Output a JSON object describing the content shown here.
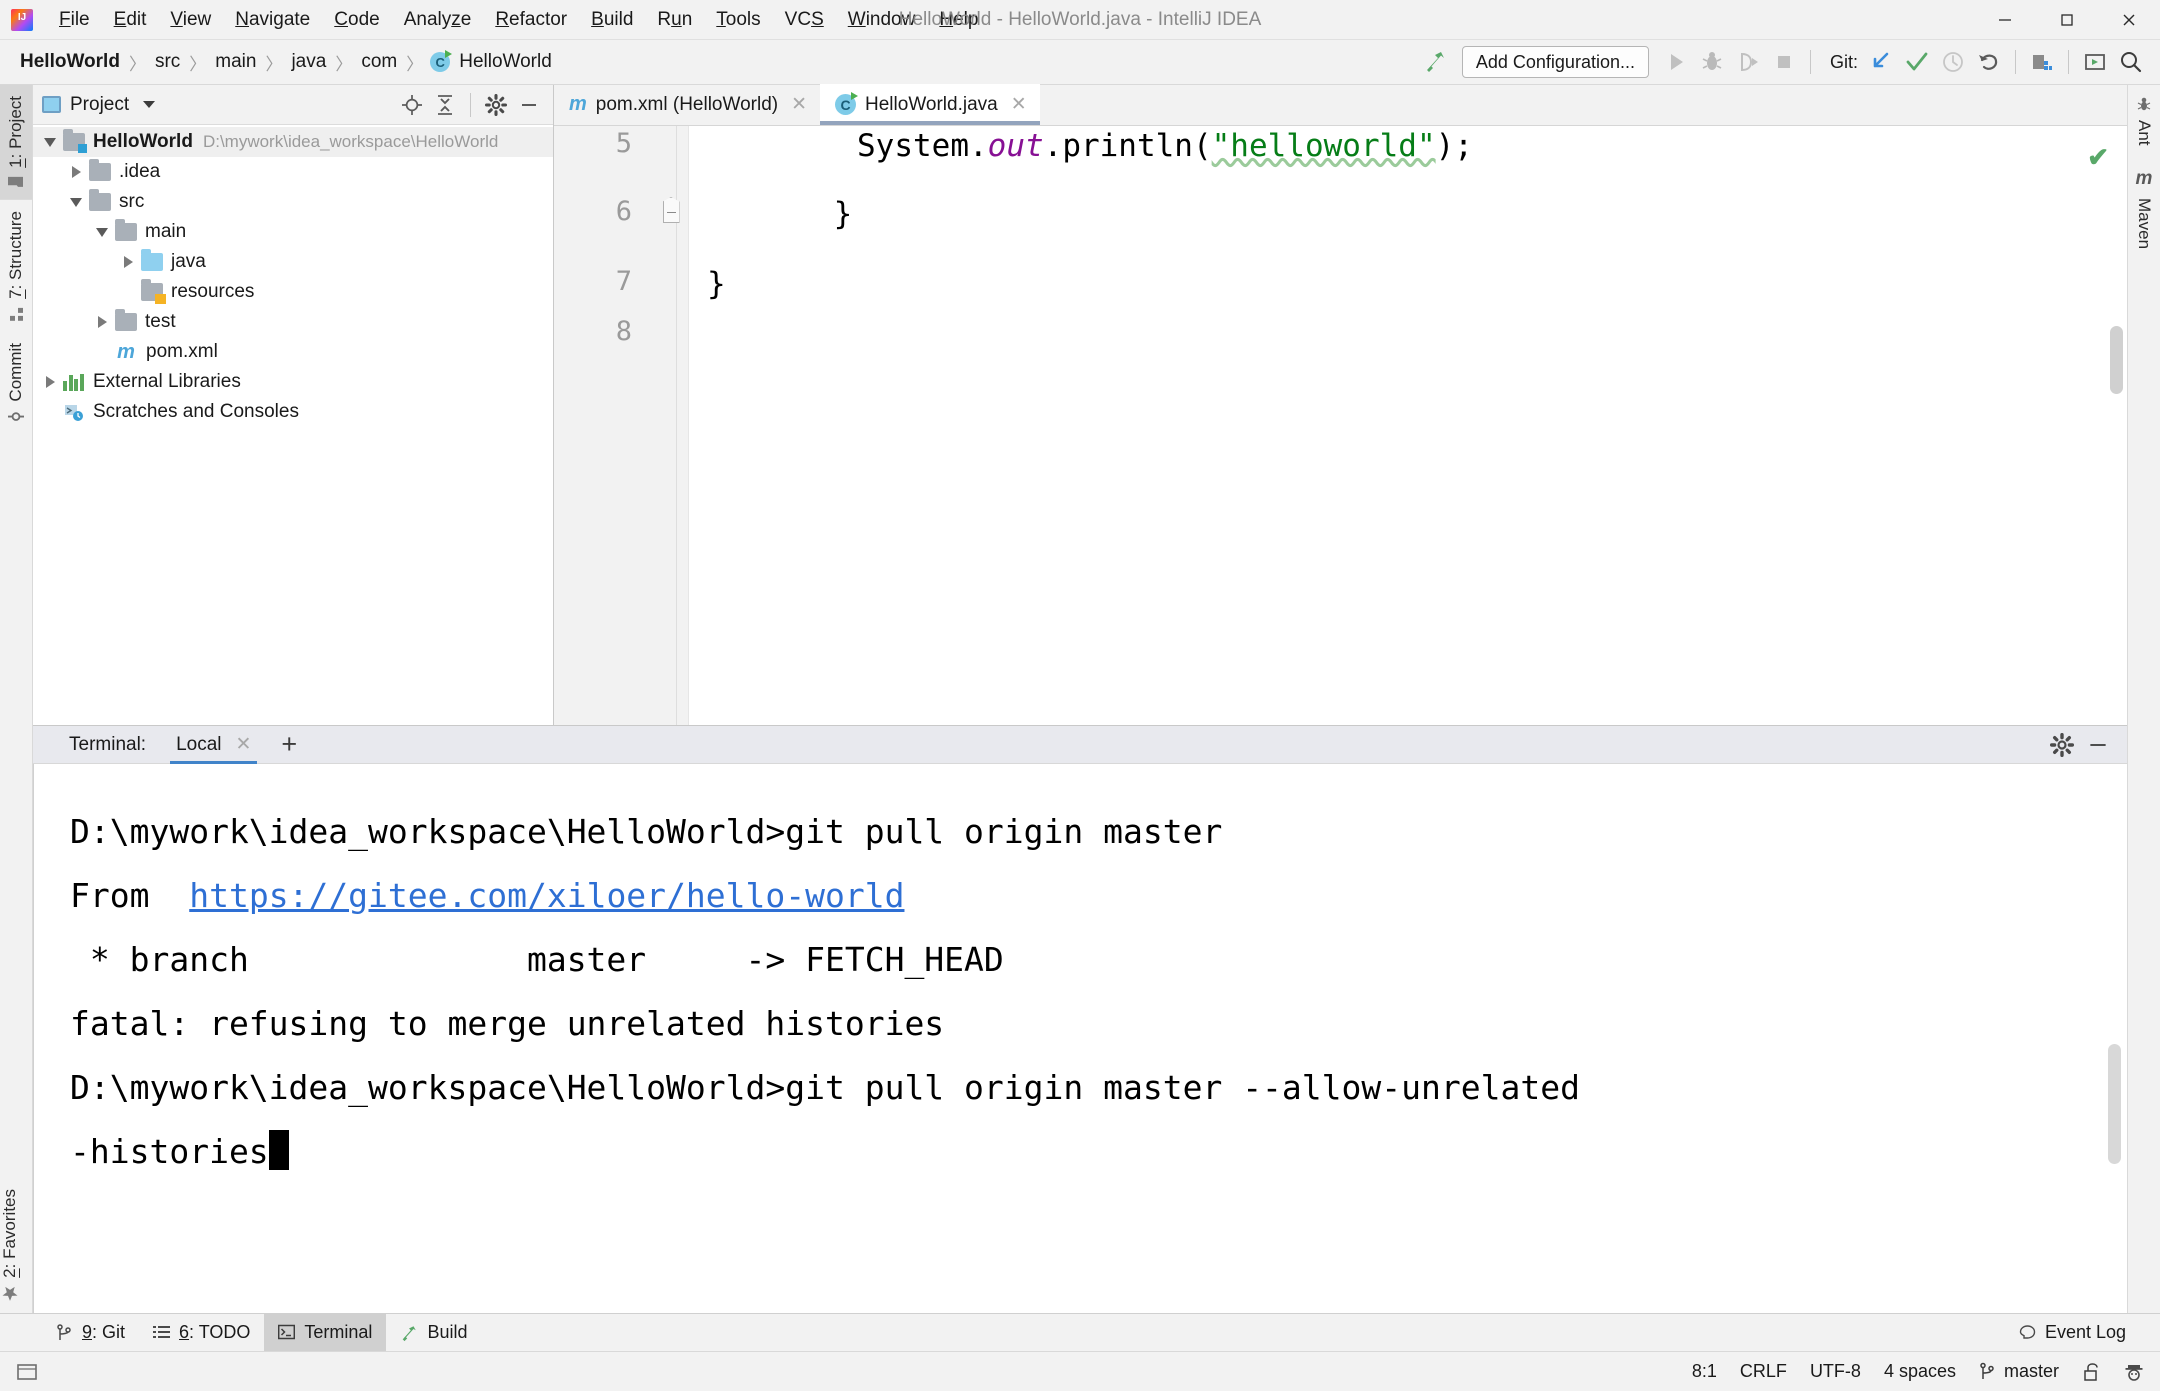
{
  "window": {
    "title": "HelloWorld - HelloWorld.java - IntelliJ IDEA",
    "minimize": "—",
    "maximize": "❐",
    "close": "✕"
  },
  "menubar": {
    "items": [
      {
        "pre": "",
        "mn": "F",
        "post": "ile"
      },
      {
        "pre": "",
        "mn": "E",
        "post": "dit"
      },
      {
        "pre": "",
        "mn": "V",
        "post": "iew"
      },
      {
        "pre": "",
        "mn": "N",
        "post": "avigate"
      },
      {
        "pre": "",
        "mn": "C",
        "post": "ode"
      },
      {
        "pre": "Analy",
        "mn": "z",
        "post": "e"
      },
      {
        "pre": "",
        "mn": "R",
        "post": "efactor"
      },
      {
        "pre": "",
        "mn": "B",
        "post": "uild"
      },
      {
        "pre": "R",
        "mn": "u",
        "post": "n"
      },
      {
        "pre": "",
        "mn": "T",
        "post": "ools"
      },
      {
        "pre": "VC",
        "mn": "S",
        "post": ""
      },
      {
        "pre": "",
        "mn": "W",
        "post": "indow"
      },
      {
        "pre": "",
        "mn": "H",
        "post": "elp"
      }
    ]
  },
  "breadcrumb": {
    "items": [
      "HelloWorld",
      "src",
      "main",
      "java",
      "com",
      "HelloWorld"
    ],
    "separator": "〉",
    "class_icon_letter": "C"
  },
  "toolbar": {
    "add_configuration": "Add Configuration...",
    "git_label": "Git:",
    "icons": [
      "build-hammer-icon",
      "run-icon",
      "debug-icon",
      "run-coverage-icon",
      "stop-icon",
      "git-update-icon",
      "git-commit-icon",
      "git-history-icon",
      "git-rollback-icon",
      "project-structure-icon",
      "select-in-icon",
      "search-everywhere-icon"
    ]
  },
  "left_toolwindows": {
    "top": [
      {
        "label_pre": "",
        "label_mn": "1",
        "label_post": ": Project",
        "icon": "project-folder-icon",
        "active": true
      },
      {
        "label_pre": "",
        "label_mn": "7",
        "label_post": ": Structure",
        "icon": "structure-icon",
        "active": false
      },
      {
        "label_pre": "Commit",
        "label_mn": "",
        "label_post": "",
        "icon": "commit-icon",
        "active": false
      }
    ],
    "bottom": [
      {
        "label_pre": "",
        "label_mn": "2",
        "label_post": ": Favorites",
        "icon": "star-icon",
        "active": false
      }
    ]
  },
  "right_toolwindows": {
    "items": [
      {
        "label": "Ant",
        "icon": "ant-icon"
      },
      {
        "label": "Maven",
        "icon": "maven-m-icon"
      }
    ]
  },
  "project_pane": {
    "title": "Project",
    "tools": [
      "locate-icon",
      "collapse-all-icon",
      "settings-gear-icon",
      "hide-icon"
    ],
    "tree": [
      {
        "indent": 0,
        "toggle": "down",
        "icon": "module-folder-icon",
        "name": "HelloWorld",
        "bold": true,
        "path": "D:\\mywork\\idea_workspace\\HelloWorld",
        "selected": true
      },
      {
        "indent": 1,
        "toggle": "right",
        "icon": "folder-gray-icon",
        "name": ".idea",
        "bold": false,
        "path": "",
        "selected": false
      },
      {
        "indent": 1,
        "toggle": "down",
        "icon": "folder-gray-icon",
        "name": "src",
        "bold": false,
        "path": "",
        "selected": false
      },
      {
        "indent": 2,
        "toggle": "down",
        "icon": "folder-gray-icon",
        "name": "main",
        "bold": false,
        "path": "",
        "selected": false
      },
      {
        "indent": 3,
        "toggle": "right",
        "icon": "folder-source-icon",
        "name": "java",
        "bold": false,
        "path": "",
        "selected": false
      },
      {
        "indent": 3,
        "toggle": "none",
        "icon": "folder-resource-icon",
        "name": "resources",
        "bold": false,
        "path": "",
        "selected": false
      },
      {
        "indent": 2,
        "toggle": "right",
        "icon": "folder-gray-icon",
        "name": "test",
        "bold": false,
        "path": "",
        "selected": false
      },
      {
        "indent": 2,
        "toggle": "none",
        "icon": "maven-file-icon",
        "name": "pom.xml",
        "bold": false,
        "path": "",
        "selected": false
      },
      {
        "indent": 0,
        "toggle": "right",
        "icon": "libraries-icon",
        "name": "External Libraries",
        "bold": false,
        "path": "",
        "selected": false
      },
      {
        "indent": 0,
        "toggle": "none",
        "icon": "scratches-icon",
        "name": "Scratches and Consoles",
        "bold": false,
        "path": "",
        "selected": false
      }
    ]
  },
  "editor": {
    "tabs": [
      {
        "label": "pom.xml (HelloWorld)",
        "icon": "maven-m-icon",
        "active": false,
        "close": "✕"
      },
      {
        "label": "HelloWorld.java",
        "icon": "java-class-icon",
        "active": true,
        "close": "✕"
      }
    ],
    "gutter_lines": [
      "5",
      "6",
      "7",
      "8"
    ],
    "code": {
      "line5": {
        "indent": "        ",
        "t1": "System.",
        "t2": "out",
        "t3": ".println(",
        "t4": "\"helloworld\"",
        "t5": ");"
      },
      "line6": "    }",
      "line7": "}",
      "line8": ""
    },
    "inspection_status": "✔"
  },
  "terminal": {
    "label": "Terminal:",
    "tab_name": "Local",
    "tab_close": "✕",
    "add_tab": "+",
    "settings_icon": "gear-icon",
    "hide_icon": "hide-icon",
    "lines": [
      {
        "type": "plain",
        "text": "D:\\mywork\\idea_workspace\\HelloWorld>git pull origin master"
      },
      {
        "type": "link",
        "prefix": "From  ",
        "text": "https://gitee.com/xiloer/hello-world"
      },
      {
        "type": "plain",
        "text": " * branch              master     -> FETCH_HEAD"
      },
      {
        "type": "plain",
        "text": "fatal: refusing to merge unrelated histories"
      },
      {
        "type": "blank",
        "text": ""
      },
      {
        "type": "plain",
        "text": "D:\\mywork\\idea_workspace\\HelloWorld>git pull origin master --allow-unrelated"
      },
      {
        "type": "cursor",
        "text": "-histories"
      }
    ]
  },
  "tool_strip": {
    "items": [
      {
        "pre": "",
        "mn": "9",
        "post": ": Git",
        "icon": "git-branch-icon",
        "active": false
      },
      {
        "pre": "",
        "mn": "6",
        "post": ": TODO",
        "icon": "todo-list-icon",
        "active": false
      },
      {
        "pre": "Terminal",
        "mn": "",
        "post": "",
        "icon": "terminal-icon",
        "active": true
      },
      {
        "pre": "Build",
        "mn": "",
        "post": "",
        "icon": "build-hammer-icon",
        "active": false
      }
    ],
    "event_log": "Event Log",
    "event_log_icon": "balloon-icon"
  },
  "statusbar": {
    "caret_position": "8:1",
    "line_separator": "CRLF",
    "encoding": "UTF-8",
    "indent": "4 spaces",
    "branch": "master",
    "branch_icon": "git-branch-icon",
    "lock_icon": "unlocked-icon",
    "inspector_icon": "hector-icon",
    "memory_icon": "memory-indicator"
  },
  "colors": {
    "accent_blue": "#4083c9",
    "string_green": "#067d17",
    "field_purple": "#871094",
    "link_blue": "#2e6fd4",
    "chrome_gray": "#f2f2f2",
    "highlight_row": "#fdf7e2"
  }
}
